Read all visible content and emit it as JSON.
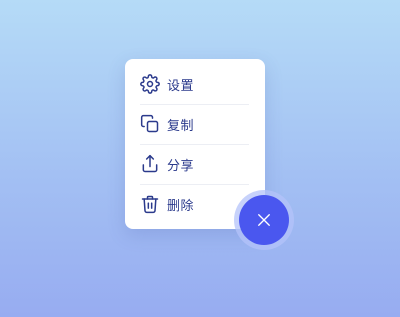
{
  "menu": {
    "items": [
      {
        "label": "设置",
        "icon": "gear-icon"
      },
      {
        "label": "复制",
        "icon": "copy-icon"
      },
      {
        "label": "分享",
        "icon": "share-icon"
      },
      {
        "label": "删除",
        "icon": "trash-icon"
      }
    ]
  },
  "fab": {
    "icon": "close-icon"
  },
  "colors": {
    "accent": "#4a57ef",
    "icon_text": "#2b3a8c",
    "background_top": "#b5dbf7",
    "background_bottom": "#97acf1"
  }
}
